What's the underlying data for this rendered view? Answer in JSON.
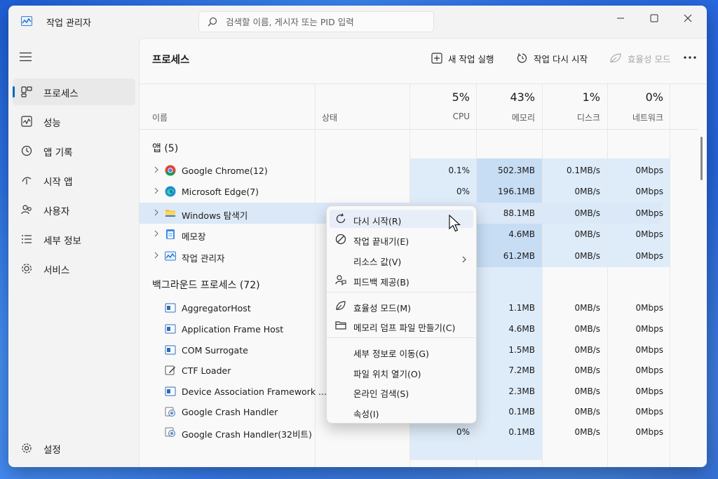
{
  "window": {
    "title": "작업 관리자"
  },
  "search": {
    "placeholder": "검색할 이름, 게시자 또는 PID 입력"
  },
  "sidebar": {
    "items": [
      {
        "label": "프로세스",
        "icon": "processes-icon",
        "active": true
      },
      {
        "label": "성능",
        "icon": "performance-icon"
      },
      {
        "label": "앱 기록",
        "icon": "history-icon"
      },
      {
        "label": "시작 앱",
        "icon": "startup-icon"
      },
      {
        "label": "사용자",
        "icon": "users-icon"
      },
      {
        "label": "세부 정보",
        "icon": "details-icon"
      },
      {
        "label": "서비스",
        "icon": "services-icon"
      }
    ],
    "settings_label": "설정"
  },
  "toolbar": {
    "page_title": "프로세스",
    "new_task": "새 작업 실행",
    "restart_task": "작업 다시 시작",
    "efficiency_mode": "효율성 모드"
  },
  "columns": {
    "name": "이름",
    "status": "상태",
    "cpu": {
      "pct": "5%",
      "label": "CPU"
    },
    "memory": {
      "pct": "43%",
      "label": "메모리"
    },
    "disk": {
      "pct": "1%",
      "label": "디스크"
    },
    "network": {
      "pct": "0%",
      "label": "네트워크"
    }
  },
  "groups": {
    "apps": "앱 (5)",
    "background": "백그라운드 프로세스 (72)"
  },
  "apps": [
    {
      "name": "Google Chrome(12)",
      "cpu": "0.1%",
      "mem": "502.3MB",
      "disk": "0.1MB/s",
      "net": "0Mbps"
    },
    {
      "name": "Microsoft Edge(7)",
      "cpu": "0%",
      "mem": "196.1MB",
      "disk": "0MB/s",
      "net": "0Mbps"
    },
    {
      "name": "Windows 탐색기",
      "cpu": "",
      "mem": "88.1MB",
      "disk": "0MB/s",
      "net": "0Mbps"
    },
    {
      "name": "메모장",
      "cpu": "",
      "mem": "4.6MB",
      "disk": "0MB/s",
      "net": "0Mbps"
    },
    {
      "name": "작업 관리자",
      "cpu": "",
      "mem": "61.2MB",
      "disk": "0MB/s",
      "net": "0Mbps"
    }
  ],
  "background": [
    {
      "name": "AggregatorHost",
      "mem": "1.1MB",
      "disk": "0MB/s",
      "net": "0Mbps"
    },
    {
      "name": "Application Frame Host",
      "mem": "4.6MB",
      "disk": "0MB/s",
      "net": "0Mbps"
    },
    {
      "name": "COM Surrogate",
      "mem": "1.5MB",
      "disk": "0MB/s",
      "net": "0Mbps"
    },
    {
      "name": "CTF Loader",
      "mem": "7.2MB",
      "disk": "0MB/s",
      "net": "0Mbps"
    },
    {
      "name": "Device Association Framework ...",
      "mem": "2.3MB",
      "disk": "0MB/s",
      "net": "0Mbps"
    },
    {
      "name": "Google Crash Handler",
      "mem": "0.1MB",
      "disk": "0MB/s",
      "net": "0Mbps"
    },
    {
      "name": "Google Crash Handler(32비트)",
      "cpu": "0%",
      "mem": "0.1MB",
      "disk": "0MB/s",
      "net": "0Mbps"
    }
  ],
  "context_menu": {
    "items": [
      {
        "label": "다시 시작(R)",
        "icon": "restart-icon"
      },
      {
        "label": "작업 끝내기(E)",
        "icon": "end-task-icon"
      },
      {
        "label": "리소스 값(V)",
        "icon": "",
        "submenu": true
      },
      {
        "label": "피드백 제공(B)",
        "icon": "feedback-icon"
      },
      {
        "label": "효율성 모드(M)",
        "icon": "leaf-icon"
      },
      {
        "label": "메모리 덤프 파일 만들기(C)",
        "icon": "folder-icon"
      },
      {
        "label": "세부 정보로 이동(G)",
        "icon": ""
      },
      {
        "label": "파일 위치 열기(O)",
        "icon": ""
      },
      {
        "label": "온라인 검색(S)",
        "icon": ""
      },
      {
        "label": "속성(I)",
        "icon": ""
      }
    ]
  },
  "colors": {
    "accent": "#0067c0",
    "heat_light": "#deecf9",
    "heat_strong": "#c7ddf4"
  }
}
